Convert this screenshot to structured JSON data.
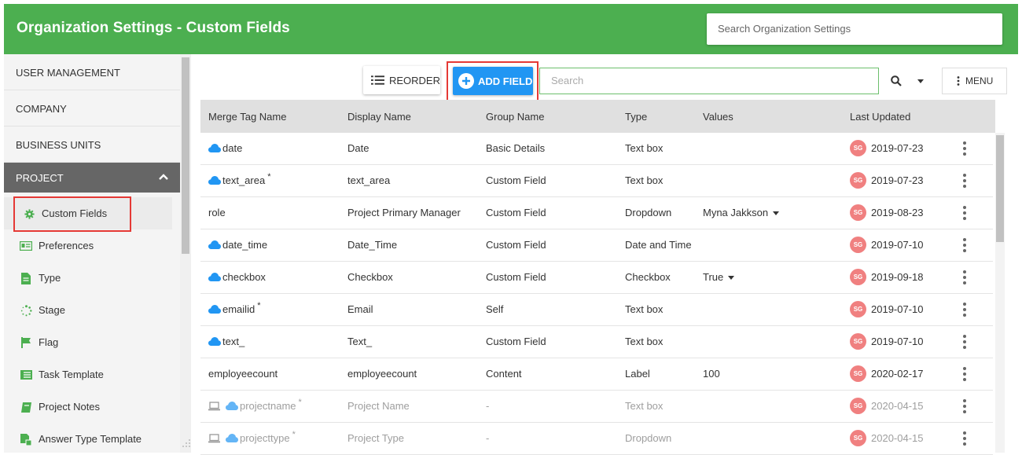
{
  "header": {
    "title": "Organization Settings - Custom Fields",
    "search_placeholder": "Search Organization Settings"
  },
  "sidebar": {
    "sections": [
      {
        "label": "USER MANAGEMENT"
      },
      {
        "label": "COMPANY"
      },
      {
        "label": "BUSINESS UNITS"
      }
    ],
    "project_label": "PROJECT",
    "sub_items": [
      {
        "label": "Custom Fields",
        "icon": "gear-icon"
      },
      {
        "label": "Preferences",
        "icon": "id-card-icon"
      },
      {
        "label": "Type",
        "icon": "document-icon"
      },
      {
        "label": "Stage",
        "icon": "dotted-circle-icon"
      },
      {
        "label": "Flag",
        "icon": "flag-icon"
      },
      {
        "label": "Task Template",
        "icon": "list-icon"
      },
      {
        "label": "Project Notes",
        "icon": "notebook-icon"
      },
      {
        "label": "Answer Type Template",
        "icon": "file-copy-icon"
      }
    ]
  },
  "toolbar": {
    "reorder_label": "REORDER",
    "add_field_label": "ADD FIELD",
    "search_placeholder": "Search",
    "menu_label": "MENU"
  },
  "table": {
    "columns": [
      "Merge Tag Name",
      "Display Name",
      "Group Name",
      "Type",
      "Values",
      "Last Updated"
    ],
    "rows": [
      {
        "merge": "date",
        "cloud": true,
        "laptop": false,
        "star": false,
        "display": "Date",
        "group": "Basic Details",
        "type": "Text box",
        "values": "",
        "has_dropdown": false,
        "initials": "SG",
        "updated": "2019-07-23",
        "muted": false
      },
      {
        "merge": "text_area",
        "cloud": true,
        "laptop": false,
        "star": true,
        "display": "text_area",
        "group": "Custom Field",
        "type": "Text box",
        "values": "",
        "has_dropdown": false,
        "initials": "SG",
        "updated": "2019-07-23",
        "muted": false
      },
      {
        "merge": "role",
        "cloud": false,
        "laptop": false,
        "star": false,
        "display": "Project Primary Manager",
        "group": "Custom Field",
        "type": "Dropdown",
        "values": "Myna Jakkson",
        "has_dropdown": true,
        "initials": "SG",
        "updated": "2019-08-23",
        "muted": false
      },
      {
        "merge": "date_time",
        "cloud": true,
        "laptop": false,
        "star": false,
        "display": "Date_Time",
        "group": "Custom Field",
        "type": "Date and Time",
        "values": "",
        "has_dropdown": false,
        "initials": "SG",
        "updated": "2019-07-10",
        "muted": false
      },
      {
        "merge": "checkbox",
        "cloud": true,
        "laptop": false,
        "star": false,
        "display": "Checkbox",
        "group": "Custom Field",
        "type": "Checkbox",
        "values": "True",
        "has_dropdown": true,
        "initials": "SG",
        "updated": "2019-09-18",
        "muted": false
      },
      {
        "merge": "emailid",
        "cloud": true,
        "laptop": false,
        "star": true,
        "display": "Email",
        "group": "Self",
        "type": "Text box",
        "values": "",
        "has_dropdown": false,
        "initials": "SG",
        "updated": "2019-07-10",
        "muted": false
      },
      {
        "merge": "text_",
        "cloud": true,
        "laptop": false,
        "star": false,
        "display": "Text_",
        "group": "Custom Field",
        "type": "Text box",
        "values": "",
        "has_dropdown": false,
        "initials": "SG",
        "updated": "2019-07-10",
        "muted": false
      },
      {
        "merge": "employeecount",
        "cloud": false,
        "laptop": false,
        "star": false,
        "display": "employeecount",
        "group": "Content",
        "type": "Label",
        "values": "100",
        "has_dropdown": false,
        "initials": "SG",
        "updated": "2020-02-17",
        "muted": false
      },
      {
        "merge": "projectname",
        "cloud": true,
        "laptop": true,
        "star": true,
        "display": "Project Name",
        "group": "-",
        "type": "Text box",
        "values": "",
        "has_dropdown": false,
        "initials": "SG",
        "updated": "2020-04-15",
        "muted": true
      },
      {
        "merge": "projecttype",
        "cloud": true,
        "laptop": true,
        "star": true,
        "display": "Project Type",
        "group": "-",
        "type": "Dropdown",
        "values": "",
        "has_dropdown": false,
        "initials": "SG",
        "updated": "2020-04-15",
        "muted": true
      }
    ]
  },
  "colors": {
    "header_green": "#4caf50",
    "add_field_blue": "#2196f3",
    "cloud_blue": "#2196f3",
    "avatar_pink": "#f08080",
    "highlight_red": "#e53935",
    "sidebar_icon_green": "#4caf50"
  }
}
